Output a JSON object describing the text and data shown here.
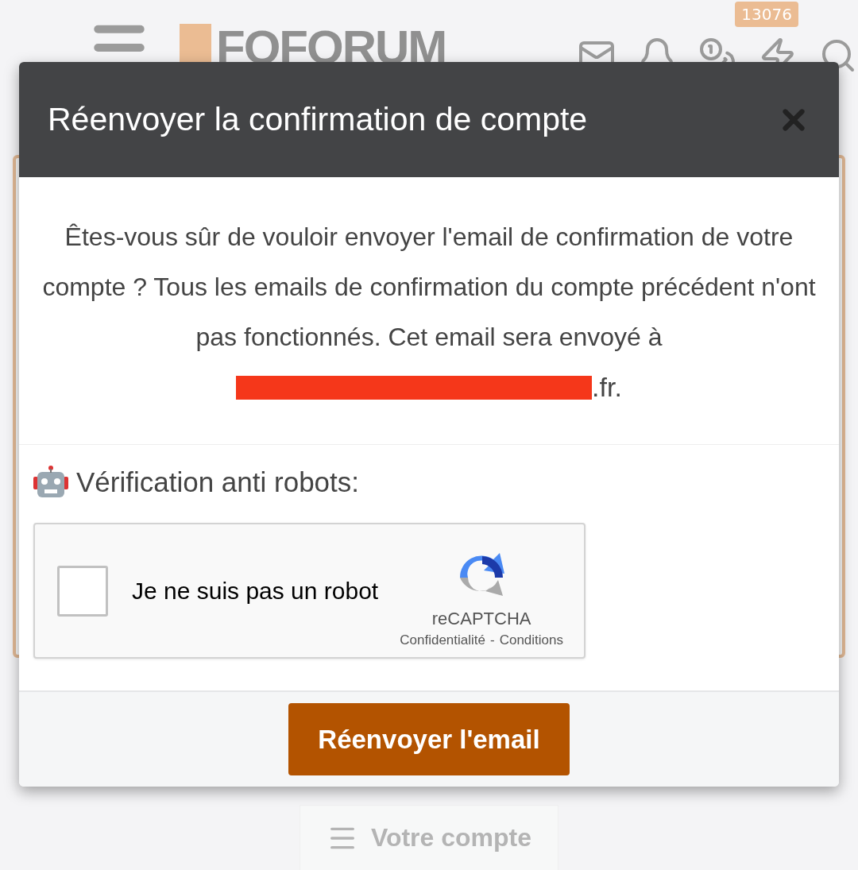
{
  "header": {
    "logo": "FOFORUM",
    "badge": "13076"
  },
  "dialog": {
    "title": "Réenvoyer la confirmation de compte",
    "message": "Êtes-vous sûr de vouloir envoyer l'email de confirmation de votre compte ? Tous les emails de confirmation du compte précédent n'ont pas fonctionnés. Cet email sera envoyé à",
    "email": {
      "redacted": true,
      "visible": ".fr."
    },
    "captcha_label": "Vérification anti robots:",
    "captcha": {
      "checked": false,
      "label": "Je ne suis pas un robot",
      "brand": "reCAPTCHA",
      "privacy": "Confidentialité",
      "separator": "-",
      "terms": "Conditions"
    },
    "submit": "Réenvoyer l'email"
  },
  "footer": {
    "account_button": "Votre compte"
  }
}
